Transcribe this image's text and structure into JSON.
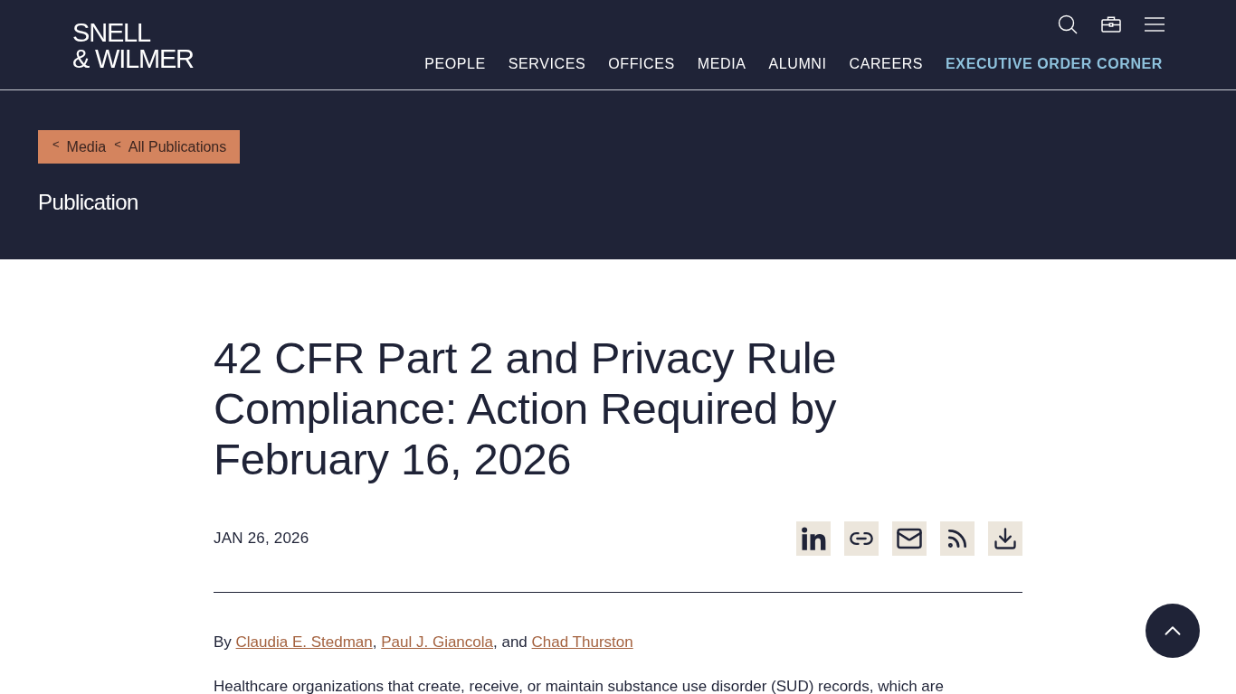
{
  "header": {
    "logo": {
      "line_1": "SNELL",
      "line_2": "& WILMER"
    },
    "nav": [
      {
        "label": "PEOPLE",
        "featured": false
      },
      {
        "label": "SERVICES",
        "featured": false
      },
      {
        "label": "OFFICES",
        "featured": false
      },
      {
        "label": "MEDIA",
        "featured": false
      },
      {
        "label": "ALUMNI",
        "featured": false
      },
      {
        "label": "CAREERS",
        "featured": false
      },
      {
        "label": "EXECUTIVE ORDER CORNER",
        "featured": true
      }
    ]
  },
  "hero": {
    "breadcrumb": [
      {
        "chevron": "<",
        "label": "Media"
      },
      {
        "chevron": "<",
        "label": "All Publications"
      }
    ],
    "section": "Publication"
  },
  "article": {
    "title": "42 CFR Part 2 and Privacy Rule Compliance: Action Required by February 16, 2026",
    "date": "JAN 26, 2026",
    "byline": [
      {
        "kind": "text",
        "text": "By "
      },
      {
        "kind": "link",
        "text": "Claudia E. Stedman"
      },
      {
        "kind": "text",
        "text": ", "
      },
      {
        "kind": "link",
        "text": "Paul J. Giancola"
      },
      {
        "kind": "text",
        "text": ", and "
      },
      {
        "kind": "link",
        "text": "Chad Thurston"
      }
    ],
    "paragraph": "Healthcare organizations that create, receive, or maintain substance use disorder (SUD) records, which are"
  }
}
